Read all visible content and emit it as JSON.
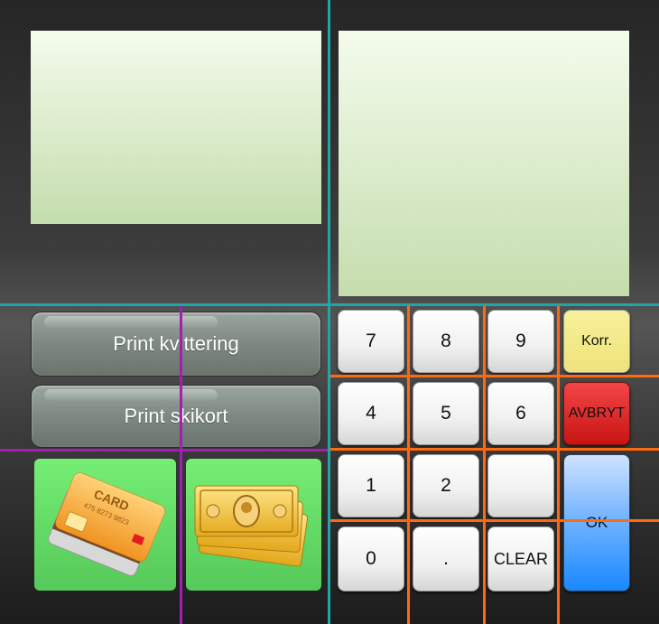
{
  "print": {
    "receipt_label": "Print kvittering",
    "skicard_label": "Print skikort"
  },
  "payment": {
    "card_label": "CARD",
    "card_number": "475 8273 9823"
  },
  "keypad": {
    "k7": "7",
    "k8": "8",
    "k9": "9",
    "korr": "Korr.",
    "k4": "4",
    "k5": "5",
    "k6": "6",
    "avbryt": "AVBRYT",
    "k1": "1",
    "k2": "2",
    "blank": "",
    "ok": "OK",
    "k0": "0",
    "dot": ".",
    "clear": "CLEAR"
  },
  "colors": {
    "teal_line": "#1fa6a6",
    "purple_line": "#a020b0",
    "orange_line": "#ff6a10"
  }
}
